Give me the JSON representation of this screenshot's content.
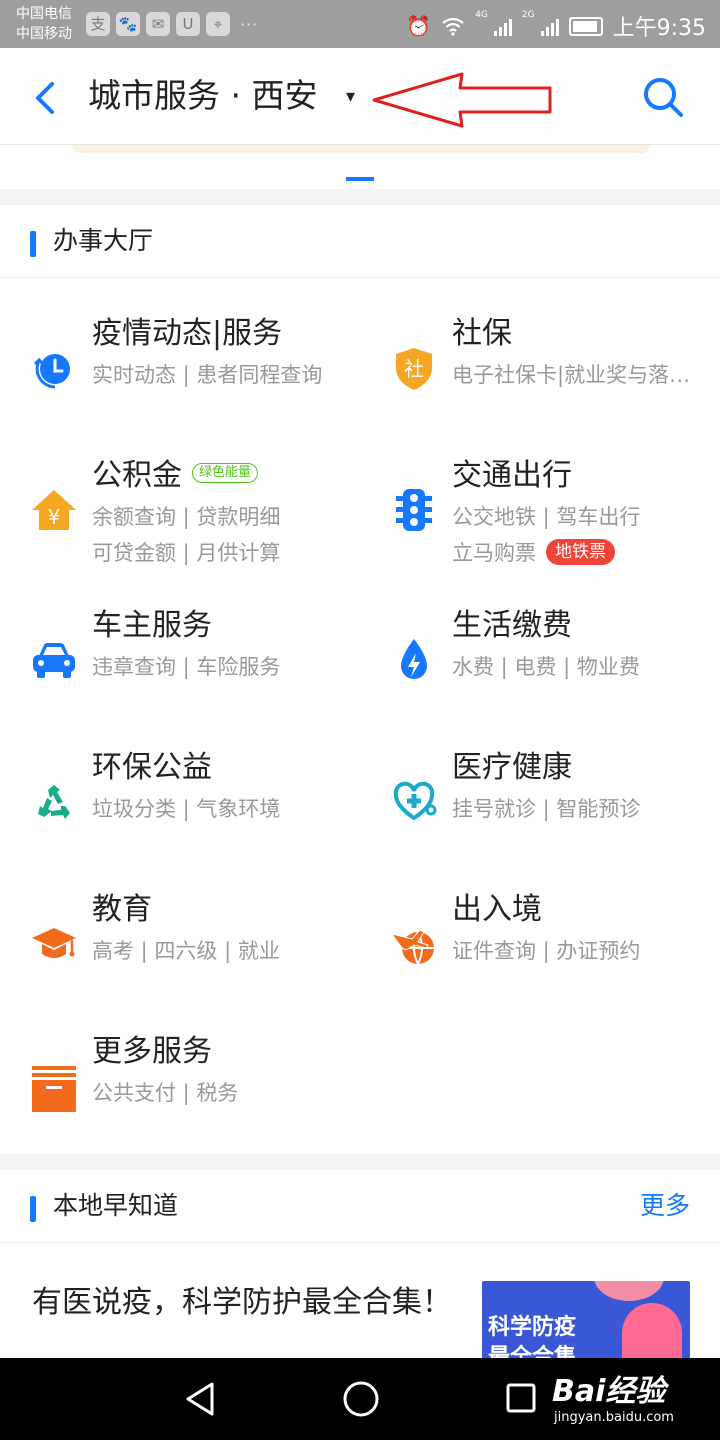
{
  "status_bar": {
    "carrier_1": "中国电信",
    "carrier_2": "中国移动",
    "app_icons": [
      "alipay-icon",
      "baidu-icon",
      "message-icon",
      "uc-browser-icon",
      "map-pin-icon"
    ],
    "more_dots": "···",
    "network_1": "4G",
    "network_2": "2G",
    "time": "上午9:35"
  },
  "header": {
    "title": "城市服务 · 西安",
    "caret": "▾"
  },
  "colors": {
    "accent_blue": "#1677ff",
    "annotation_red": "#e02020",
    "tag_green": "#52c41a",
    "tag_red": "#f0433a"
  },
  "hall": {
    "title": "办事大厅",
    "services": [
      {
        "name": "疫情动态|服务",
        "icon": "clock-refresh-icon",
        "lines": [
          "实时动态 | 患者同程查询"
        ]
      },
      {
        "name": "社保",
        "icon": "social-security-shield-icon",
        "icon_text": "社",
        "lines": [
          "电子社保卡|就业奖与落…"
        ]
      },
      {
        "name": "公积金",
        "icon": "house-yuan-icon",
        "icon_text": "¥",
        "tag": "绿色能量",
        "lines": [
          "余额查询 | 贷款明细",
          "可贷金额 | 月供计算"
        ]
      },
      {
        "name": "交通出行",
        "icon": "traffic-light-icon",
        "lines": [
          "公交地铁 | 驾车出行",
          "立马购票"
        ],
        "tag": "地铁票"
      },
      {
        "name": "车主服务",
        "icon": "car-icon",
        "lines": [
          "违章查询 | 车险服务"
        ]
      },
      {
        "name": "生活缴费",
        "icon": "water-drop-bolt-icon",
        "lines": [
          "水费 | 电费 | 物业费"
        ]
      },
      {
        "name": "环保公益",
        "icon": "recycle-icon",
        "lines": [
          "垃圾分类 | 气象环境"
        ]
      },
      {
        "name": "医疗健康",
        "icon": "stethoscope-heart-icon",
        "lines": [
          "挂号就诊 | 智能预诊"
        ]
      },
      {
        "name": "教育",
        "icon": "graduation-cap-icon",
        "lines": [
          "高考 | 四六级 | 就业"
        ]
      },
      {
        "name": "出入境",
        "icon": "plane-globe-icon",
        "lines": [
          "证件查询 | 办证预约"
        ]
      },
      {
        "name": "更多服务",
        "icon": "box-icon",
        "lines": [
          "公共支付 | 税务"
        ]
      }
    ]
  },
  "local": {
    "title": "本地早知道",
    "more": "更多",
    "article": {
      "title": "有医说疫，科学防护最全合集！",
      "thumb_text_1": "科学防疫",
      "thumb_text_2": "最全合集"
    }
  },
  "watermark": {
    "brand": "Bai经验",
    "url": "jingyan.baidu.com"
  }
}
